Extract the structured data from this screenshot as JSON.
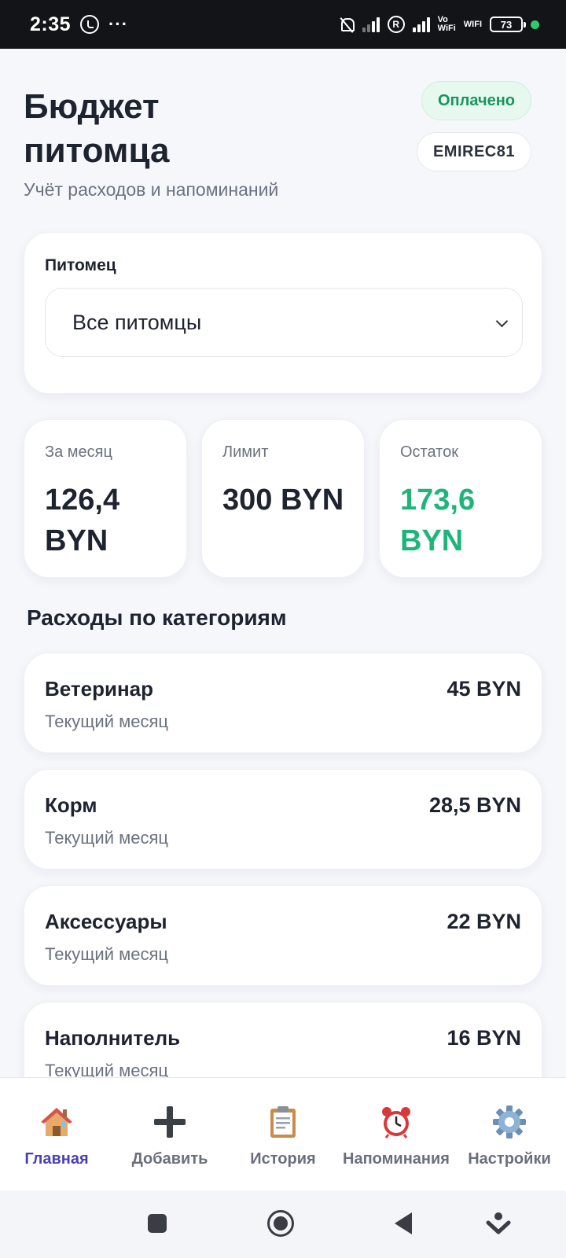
{
  "status_bar": {
    "time": "2:35",
    "dots": "···",
    "registered": "R",
    "vowifi": "Vo\nWiFi",
    "wifi": "WIFI",
    "battery": "73"
  },
  "header": {
    "title": "Бюджет питомца",
    "subtitle": "Учёт расходов и напоминаний",
    "status_badge": "Оплачено",
    "user_badge": "EMIREC81"
  },
  "pet_filter": {
    "label": "Питомец",
    "selected": "Все питомцы"
  },
  "stats": [
    {
      "label": "За месяц",
      "value": "126,4 BYN"
    },
    {
      "label": "Лимит",
      "value": "300 BYN"
    },
    {
      "label": "Остаток",
      "value": "173,6 BYN"
    }
  ],
  "categories_section": {
    "title": "Расходы по категориям",
    "items": [
      {
        "name": "Ветеринар",
        "period": "Текущий месяц",
        "amount": "45 BYN"
      },
      {
        "name": "Корм",
        "period": "Текущий месяц",
        "amount": "28,5 BYN"
      },
      {
        "name": "Аксессуары",
        "period": "Текущий месяц",
        "amount": "22 BYN"
      },
      {
        "name": "Наполнитель",
        "period": "Текущий месяц",
        "amount": "16 BYN"
      }
    ]
  },
  "bottom_nav": [
    {
      "label": "Главная",
      "icon": "house-icon",
      "active": true
    },
    {
      "label": "Добавить",
      "icon": "plus-icon",
      "active": false
    },
    {
      "label": "История",
      "icon": "clipboard-icon",
      "active": false
    },
    {
      "label": "Напоминания",
      "icon": "alarm-clock-icon",
      "active": false
    },
    {
      "label": "Настройки",
      "icon": "gear-icon",
      "active": false
    }
  ],
  "colors": {
    "accent_green": "#1fb57a",
    "nav_active": "#4b3fb8",
    "badge_paid_bg": "#e7f8ef",
    "badge_paid_text": "#17955c"
  }
}
